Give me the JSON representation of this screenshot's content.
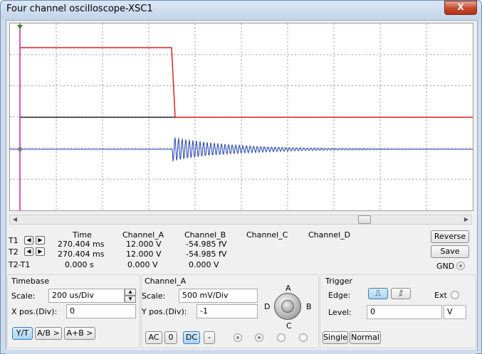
{
  "window": {
    "title": "Four channel oscilloscope-XSC1",
    "close_label": "X"
  },
  "colors": {
    "channel_a": "#e02020",
    "channel_b": "#2040b0",
    "trace_black": "#000000",
    "cursor": "#c020c0",
    "grid": "#999999"
  },
  "cursors": {
    "t1_label": "T1",
    "t2_label": "T2",
    "diff_label": "T2-T1",
    "headers": [
      "Time",
      "Channel_A",
      "Channel_B",
      "Channel_C",
      "Channel_D"
    ],
    "t1": {
      "time": "270.404 ms",
      "channel_a": "12.000 V",
      "channel_b": "-54.985 fV"
    },
    "t2": {
      "time": "270.404 ms",
      "channel_a": "12.000 V",
      "channel_b": "-54.985 fV"
    },
    "diff": {
      "time": "0.000 s",
      "channel_a": "0.000 V",
      "channel_b": "0.000 V"
    }
  },
  "buttons": {
    "reverse": "Reverse",
    "save": "Save",
    "gnd": "GND"
  },
  "timebase": {
    "title": "Timebase",
    "scale_label": "Scale:",
    "scale_value": "200 us/Div",
    "xpos_label": "X pos.(Div):",
    "xpos_value": "0",
    "mode_yt": "Y/T",
    "mode_ab": "A/B >",
    "mode_apb": "A+B >"
  },
  "channel": {
    "title": "Channel_A",
    "scale_label": "Scale:",
    "scale_value": "500 mV/Div",
    "ypos_label": "Y pos.(Div):",
    "ypos_value": "-1",
    "coupling_ac": "AC",
    "coupling_0": "0",
    "coupling_dc": "DC",
    "invert": "-",
    "knob_labels": {
      "a": "A",
      "b": "B",
      "c": "C",
      "d": "D"
    }
  },
  "trigger": {
    "title": "Trigger",
    "edge_label": "Edge:",
    "level_label": "Level:",
    "level_value": "0",
    "level_unit": "V",
    "ext_label": "Ext",
    "single": "Single",
    "normal": "Normal"
  },
  "chart_data": {
    "type": "line",
    "series": [
      {
        "name": "Channel_A",
        "color": "#e02020",
        "description_levels": [
          12,
          0
        ]
      },
      {
        "name": "Channel_B",
        "color": "#2040b0"
      }
    ]
  }
}
